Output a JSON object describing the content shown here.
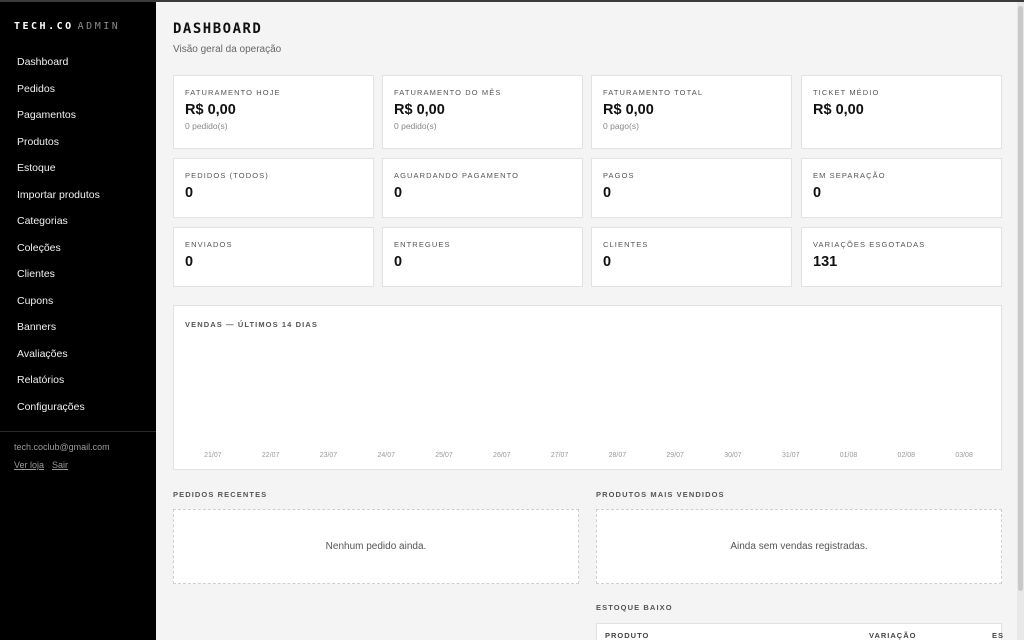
{
  "sidebar": {
    "brand": "TECH.CO",
    "brand_sub": "ADMIN",
    "items": [
      {
        "label": "Dashboard"
      },
      {
        "label": "Pedidos"
      },
      {
        "label": "Pagamentos"
      },
      {
        "label": "Produtos"
      },
      {
        "label": "Estoque"
      },
      {
        "label": "Importar produtos"
      },
      {
        "label": "Categorias"
      },
      {
        "label": "Coleções"
      },
      {
        "label": "Clientes"
      },
      {
        "label": "Cupons"
      },
      {
        "label": "Banners"
      },
      {
        "label": "Avaliações"
      },
      {
        "label": "Relatórios"
      },
      {
        "label": "Configurações"
      }
    ],
    "email": "tech.coclub@gmail.com",
    "view_store": "Ver loja",
    "logout": "Sair"
  },
  "header": {
    "title": "DASHBOARD",
    "subtitle": "Visão geral da operação"
  },
  "stats": [
    {
      "label": "FATURAMENTO HOJE",
      "value": "R$ 0,00",
      "sub": "0 pedido(s)"
    },
    {
      "label": "FATURAMENTO DO MÊS",
      "value": "R$ 0,00",
      "sub": "0 pedido(s)"
    },
    {
      "label": "FATURAMENTO TOTAL",
      "value": "R$ 0,00",
      "sub": "0 pago(s)"
    },
    {
      "label": "TICKET MÉDIO",
      "value": "R$ 0,00",
      "sub": ""
    },
    {
      "label": "PEDIDOS (TODOS)",
      "value": "0",
      "sub": ""
    },
    {
      "label": "AGUARDANDO PAGAMENTO",
      "value": "0",
      "sub": ""
    },
    {
      "label": "PAGOS",
      "value": "0",
      "sub": ""
    },
    {
      "label": "EM SEPARAÇÃO",
      "value": "0",
      "sub": ""
    },
    {
      "label": "ENVIADOS",
      "value": "0",
      "sub": ""
    },
    {
      "label": "ENTREGUES",
      "value": "0",
      "sub": ""
    },
    {
      "label": "CLIENTES",
      "value": "0",
      "sub": ""
    },
    {
      "label": "VARIAÇÕES ESGOTADAS",
      "value": "131",
      "sub": ""
    }
  ],
  "chart_data": {
    "type": "bar",
    "title": "VENDAS — ÚLTIMOS 14 DIAS",
    "categories": [
      "21/07",
      "22/07",
      "23/07",
      "24/07",
      "25/07",
      "26/07",
      "27/07",
      "28/07",
      "29/07",
      "30/07",
      "31/07",
      "01/08",
      "02/08",
      "03/08"
    ],
    "values": [
      0,
      0,
      0,
      0,
      0,
      0,
      0,
      0,
      0,
      0,
      0,
      0,
      0,
      0
    ],
    "xlabel": "",
    "ylabel": "",
    "grid": false
  },
  "recent_orders": {
    "title": "PEDIDOS RECENTES",
    "empty": "Nenhum pedido ainda."
  },
  "top_products": {
    "title": "PRODUTOS MAIS VENDIDOS",
    "empty": "Ainda sem vendas registradas."
  },
  "low_stock": {
    "title": "ESTOQUE BAIXO",
    "columns": [
      "PRODUTO",
      "VARIAÇÃO",
      "ES"
    ]
  }
}
